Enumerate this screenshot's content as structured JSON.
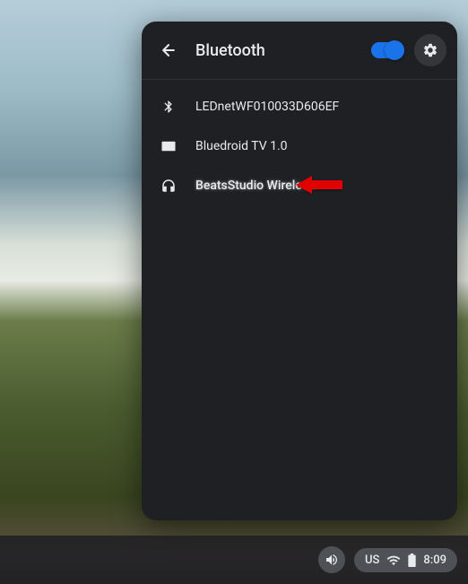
{
  "panel": {
    "title": "Bluetooth",
    "toggle_on": true
  },
  "devices": [
    {
      "icon": "bluetooth",
      "name": "LEDnetWF010033D606EF",
      "highlighted": false
    },
    {
      "icon": "display",
      "name": "Bluedroid TV 1.0",
      "highlighted": false
    },
    {
      "icon": "headphones",
      "name": "BeatsStudio Wireless",
      "highlighted": true
    }
  ],
  "shelf": {
    "keyboard": "US",
    "time": "8:09"
  }
}
